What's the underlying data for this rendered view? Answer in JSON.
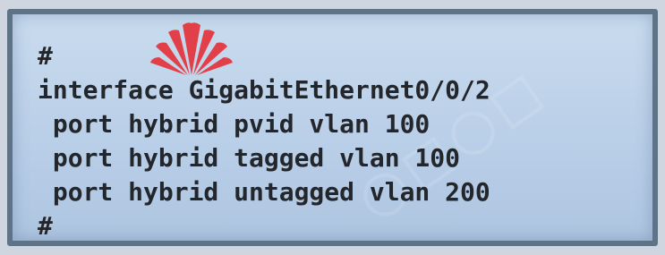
{
  "config": {
    "lines": [
      "#",
      "interface GigabitEthernet0/0/2",
      " port hybrid pvid vlan 100",
      " port hybrid tagged vlan 100",
      " port hybrid untagged vlan 200",
      "#"
    ]
  },
  "logo": {
    "icon": "huawei-logo-icon",
    "color": "#e8262d"
  },
  "colors": {
    "panel_bg": "#bfd3ea",
    "border": "#5f7386",
    "text": "#23262b"
  }
}
